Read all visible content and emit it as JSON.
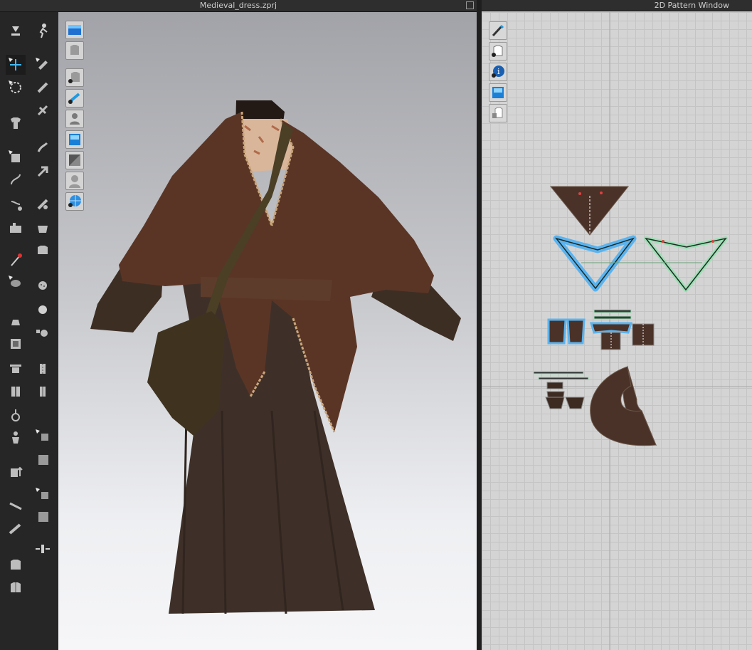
{
  "window": {
    "left_title": "Medieval_dress.zprj",
    "right_title": "2D Pattern Window"
  },
  "colors": {
    "cloak": "#5a3526",
    "dress": "#3e3028",
    "belt": "#5e3c2c",
    "bag": "#3f3320",
    "pattern_fill": "#4a3228",
    "pattern_selected": "#5ab3ef",
    "pattern_green": "#9be0b4"
  },
  "toolbar_icons": [
    "simulation-icon",
    "avatar-walk-icon",
    "transform-icon",
    "select-move-icon",
    "edit-pattern-icon",
    "edit-curve-icon",
    "fold-arrangement-icon",
    "tack-icon",
    "flatten-icon",
    "pin-icon",
    "sewing-icon",
    "topstitch-icon",
    "button-icon",
    "buttonhole-icon",
    "zipper-icon",
    "measure-icon",
    "fabric-icon",
    "graphic-icon",
    "avatar-icon",
    "hanger-icon"
  ],
  "viewport_icons": [
    "show-avatar-icon",
    "show-garment-icon",
    "show-pin-icon",
    "show-texture-icon",
    "show-mesh-icon",
    "show-shadow-icon",
    "show-avatar-body-icon",
    "show-global-icon"
  ],
  "pattern_icons": [
    "pattern-edit-icon",
    "pattern-show-garment-icon",
    "pattern-info-icon",
    "pattern-texture-icon",
    "pattern-lock-icon"
  ]
}
